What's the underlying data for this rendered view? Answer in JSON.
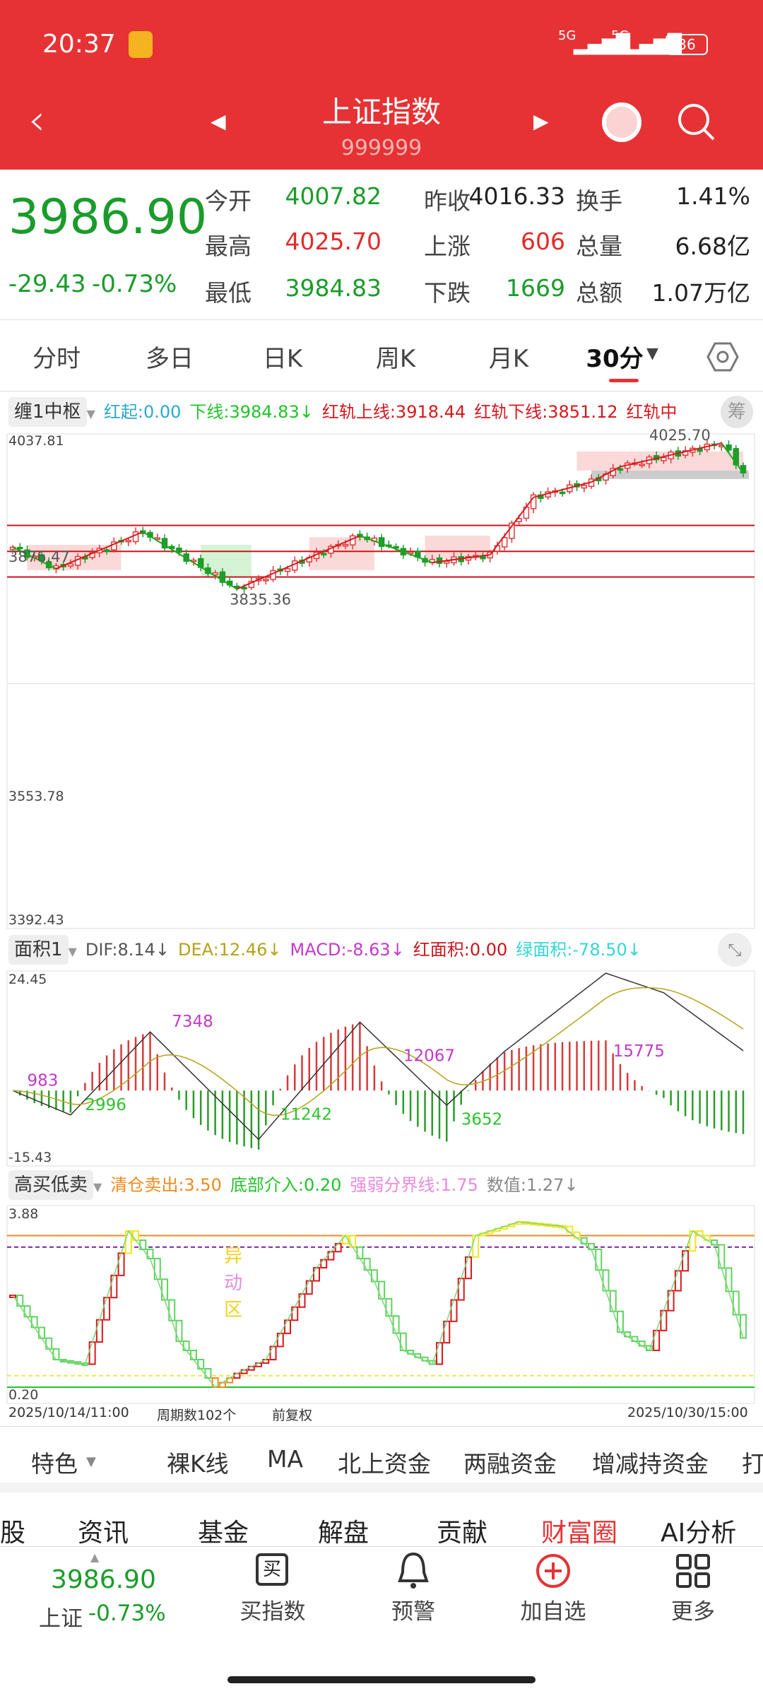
{
  "status": {
    "time": "20:37",
    "net1": "5G",
    "net2": "5G",
    "battery": "36"
  },
  "header": {
    "title": "上证指数",
    "code": "999999"
  },
  "quote": {
    "price": "3986.90",
    "change": "-29.43",
    "change_pct": "-0.73%",
    "rows": [
      [
        {
          "label": "今开",
          "value": "4007.82",
          "color": "grn"
        },
        {
          "label": "昨收",
          "value": "4016.33",
          "color": "blk"
        },
        {
          "label": "换手",
          "value": "1.41%",
          "color": "blk"
        }
      ],
      [
        {
          "label": "最高",
          "value": "4025.70",
          "color": "red"
        },
        {
          "label": "上涨",
          "value": "606",
          "color": "red"
        },
        {
          "label": "总量",
          "value": "6.68亿",
          "color": "blk"
        }
      ],
      [
        {
          "label": "最低",
          "value": "3984.83",
          "color": "grn"
        },
        {
          "label": "下跌",
          "value": "1669",
          "color": "grn"
        },
        {
          "label": "总额",
          "value": "1.07万亿",
          "color": "blk"
        }
      ]
    ]
  },
  "tabs": [
    "分时",
    "多日",
    "日K",
    "周K",
    "月K",
    "30分"
  ],
  "active_tab": "30分",
  "main_indicator": {
    "name": "缠1中枢",
    "items": [
      {
        "text": "红起:0.00",
        "color": "#2aa9c9"
      },
      {
        "text": "下线:3984.83↓",
        "color": "#22c32a"
      },
      {
        "text": "红轨上线:3918.44",
        "color": "#d8181c"
      },
      {
        "text": "红轨下线:3851.12",
        "color": "#d8181c"
      },
      {
        "text": "红轨中",
        "color": "#d8181c"
      }
    ],
    "chip_label": "筹"
  },
  "macd_indicator": {
    "name": "面积1",
    "items": [
      {
        "text": "DIF:8.14↓",
        "color": "#555"
      },
      {
        "text": "DEA:12.46↓",
        "color": "#b5a21a"
      },
      {
        "text": "MACD:-8.63↓",
        "color": "#c23ac9"
      },
      {
        "text": "红面积:0.00",
        "color": "#c8161c"
      },
      {
        "text": "绿面积:-78.50↓",
        "color": "#33d6d6"
      }
    ]
  },
  "gmdm_indicator": {
    "name": "高买低卖",
    "items": [
      {
        "text": "清仓卖出:3.50",
        "color": "#f08a1c"
      },
      {
        "text": "底部介入:0.20",
        "color": "#22c32a"
      },
      {
        "text": "强弱分界线:1.75",
        "color": "#e88ae0"
      },
      {
        "text": "数值:1.27↓",
        "color": "#888"
      }
    ]
  },
  "chart_data": [
    {
      "type": "candlestick",
      "name": "main",
      "ylim": [
        3392.43,
        4037.81
      ],
      "y_ticks": [
        "4037.81",
        "3553.78",
        "3392.43"
      ],
      "bars": 102,
      "close_keypoints": [
        [
          0,
          3890
        ],
        [
          6,
          3862
        ],
        [
          18,
          3910
        ],
        [
          31,
          3835.36
        ],
        [
          48,
          3905
        ],
        [
          58,
          3870
        ],
        [
          66,
          3880
        ],
        [
          72,
          3955
        ],
        [
          80,
          3975
        ],
        [
          84,
          3995
        ],
        [
          98,
          4025.7
        ],
        [
          101,
          3986.9
        ]
      ],
      "hlines": [
        3918.44,
        3884.5,
        3851.12
      ],
      "annotations": [
        "4025.70",
        "3835.36",
        "3876.47"
      ]
    },
    {
      "type": "macd",
      "name": "macd",
      "ylim": [
        -15.43,
        24.45
      ],
      "y_ticks": [
        "24.45",
        "-15.43"
      ],
      "dif_keypoints": [
        [
          0,
          0
        ],
        [
          8,
          -5
        ],
        [
          19,
          12
        ],
        [
          34,
          -10
        ],
        [
          48,
          14
        ],
        [
          60,
          -3
        ],
        [
          68,
          8
        ],
        [
          82,
          24
        ],
        [
          90,
          20
        ],
        [
          101,
          8.14
        ]
      ],
      "area_labels": [
        {
          "text": "983",
          "i": 2,
          "v": 1,
          "color": "#c23ac9"
        },
        {
          "text": "2996",
          "i": 10,
          "v": -4,
          "color": "#2ec22e"
        },
        {
          "text": "7348",
          "i": 22,
          "v": 13,
          "color": "#c23ac9"
        },
        {
          "text": "11242",
          "i": 37,
          "v": -6,
          "color": "#2ec22e"
        },
        {
          "text": "12067",
          "i": 54,
          "v": 6,
          "color": "#c23ac9"
        },
        {
          "text": "3652",
          "i": 62,
          "v": -7,
          "color": "#2ec22e"
        },
        {
          "text": "15775",
          "i": 83,
          "v": 7,
          "color": "#c23ac9"
        }
      ]
    },
    {
      "type": "step",
      "name": "gmdm",
      "ylim": [
        0.2,
        3.88
      ],
      "y_ticks": [
        "3.88",
        "0.20"
      ],
      "value_keypoints": [
        [
          0,
          2.2
        ],
        [
          6,
          0.8
        ],
        [
          10,
          0.7
        ],
        [
          16,
          3.6
        ],
        [
          19,
          3.0
        ],
        [
          23,
          1.2
        ],
        [
          28,
          0.2
        ],
        [
          31,
          0.5
        ],
        [
          35,
          0.8
        ],
        [
          42,
          2.8
        ],
        [
          46,
          3.5
        ],
        [
          50,
          2.5
        ],
        [
          54,
          1.0
        ],
        [
          58,
          0.7
        ],
        [
          64,
          3.5
        ],
        [
          70,
          3.8
        ],
        [
          76,
          3.7
        ],
        [
          80,
          3.2
        ],
        [
          84,
          1.4
        ],
        [
          88,
          1.0
        ],
        [
          94,
          3.6
        ],
        [
          97,
          3.3
        ],
        [
          101,
          1.27
        ]
      ],
      "lines": [
        {
          "v": 3.5,
          "color": "#f08a1c"
        },
        {
          "v": 3.25,
          "color": "#7a1fa8",
          "dash": true
        },
        {
          "v": 0.45,
          "color": "#e8e84a",
          "dash": true
        },
        {
          "v": 0.2,
          "color": "#22c32a"
        }
      ],
      "zone_label": [
        "异",
        "动",
        "区"
      ],
      "x_start": "2025/10/14/11:00",
      "x_end": "2025/10/30/15:00",
      "period_count": "周期数102个",
      "adjust": "前复权"
    }
  ],
  "toolbar": [
    "特色",
    "裸K线",
    "MA",
    "北上资金",
    "两融资金",
    "增减持资金",
    "打"
  ],
  "news_tabs": [
    "股",
    "资讯",
    "基金",
    "解盘",
    "贡献",
    "财富圈",
    "AI分析"
  ],
  "active_news_tab": "财富圈",
  "bottom": {
    "price": "3986.90",
    "name": "上证",
    "pct": "-0.73%",
    "items": [
      "买指数",
      "预警",
      "加自选",
      "更多"
    ],
    "buy_glyph": "买"
  }
}
